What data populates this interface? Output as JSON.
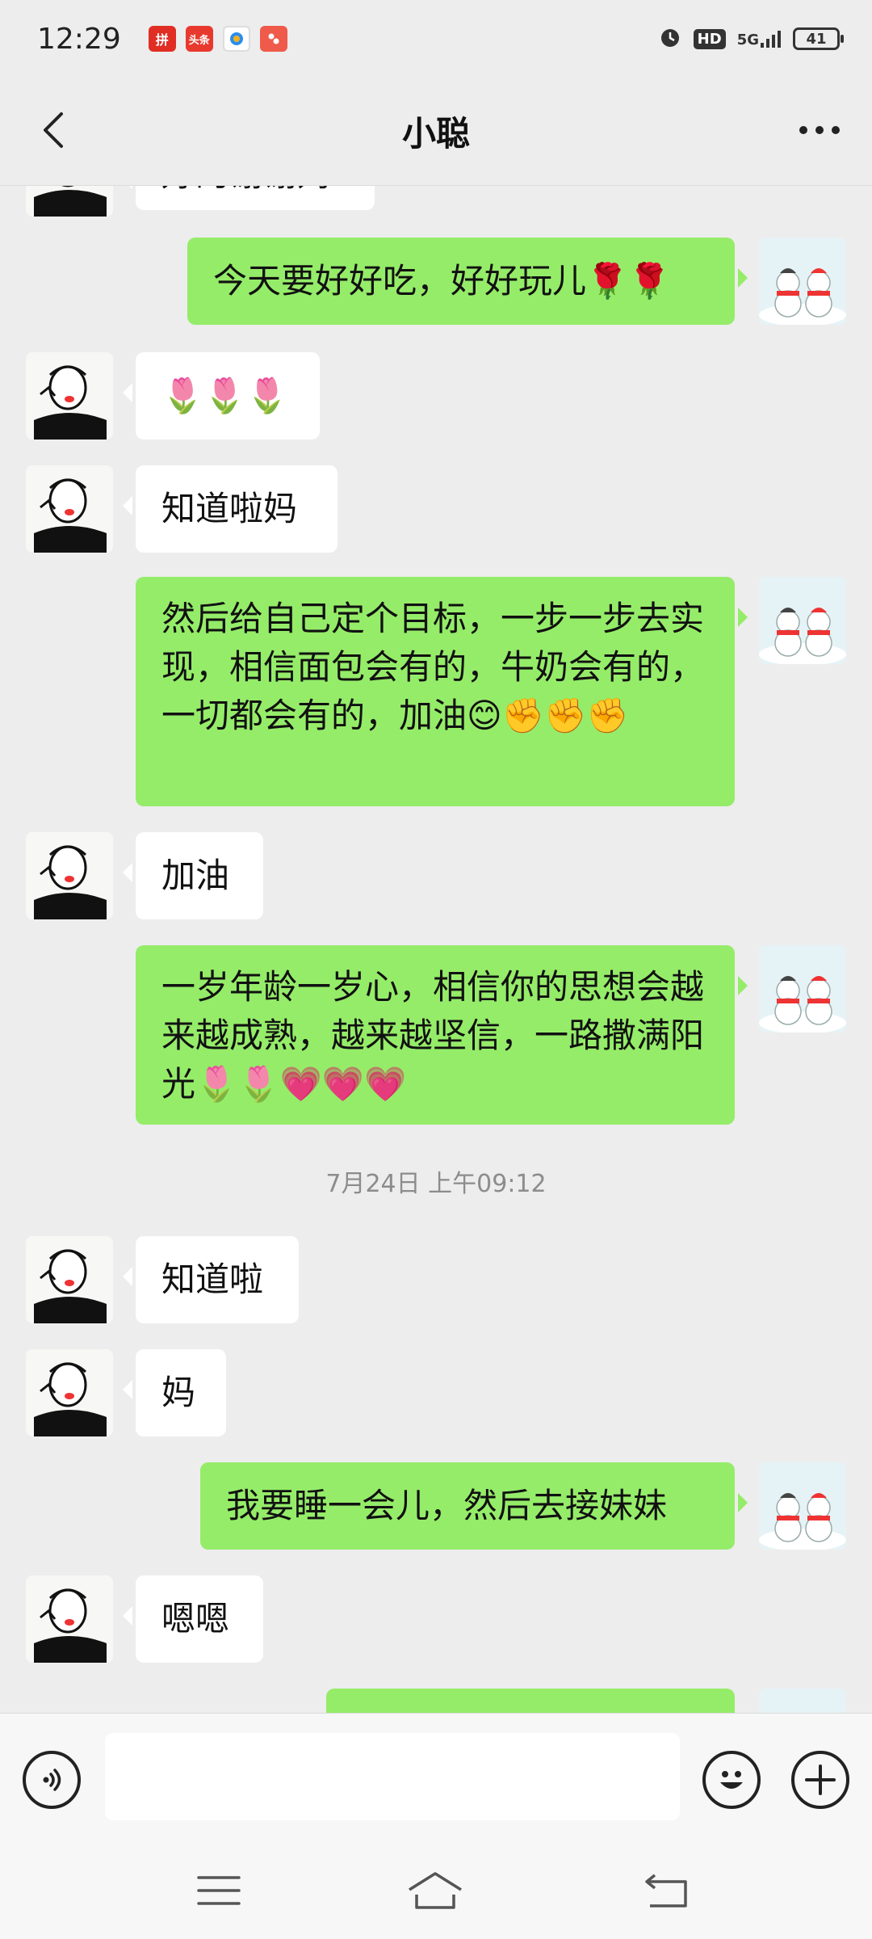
{
  "status_bar": {
    "time": "12:29",
    "notifications": [
      {
        "name": "pinduoduo-icon",
        "label": "拼",
        "color": "#e02e24"
      },
      {
        "name": "toutiao-icon",
        "label": "头条",
        "color": "#e8392f"
      },
      {
        "name": "browser-icon",
        "label": "",
        "color": "#2a8ef0"
      },
      {
        "name": "app-icon",
        "label": "",
        "color": "#ef5a4a"
      }
    ],
    "hd": "HD",
    "network": "5G",
    "battery": "41"
  },
  "header": {
    "title": "小聪",
    "back_icon": "chevron-left-icon",
    "more_icon": "more-dots-icon"
  },
  "messages": [
    {
      "id": "m0",
      "side": "other",
      "text": "好的谢谢妈",
      "partial": true
    },
    {
      "id": "m1",
      "side": "self",
      "text": "今天要好好吃，好好玩儿🌹🌹"
    },
    {
      "id": "m2",
      "side": "other",
      "text": "🌷🌷🌷"
    },
    {
      "id": "m3",
      "side": "other",
      "text": "知道啦妈"
    },
    {
      "id": "m4",
      "side": "self",
      "text": "然后给自己定个目标，一步一步去实现，相信面包会有的，牛奶会有的，一切都会有的，加油😊✊✊✊"
    },
    {
      "id": "m5",
      "side": "other",
      "text": "加油"
    },
    {
      "id": "m6",
      "side": "self",
      "text": "一岁年龄一岁心，相信你的思想会越来越成熟，越来越坚信，一路撒满阳光🌷🌷💗💗💗"
    },
    {
      "id": "m7",
      "side": "other",
      "text": "知道啦"
    },
    {
      "id": "m8",
      "side": "other",
      "text": "妈"
    },
    {
      "id": "m9",
      "side": "self",
      "text": "我要睡一会儿，然后去接妹妹"
    },
    {
      "id": "m10",
      "side": "other",
      "text": "嗯嗯"
    }
  ],
  "timestamp": "7月24日 上午09:12",
  "input_bar": {
    "voice_icon": "voice-icon",
    "text_value": "",
    "emoji_icon": "emoji-icon",
    "add_icon": "plus-icon"
  },
  "system_nav": {
    "menu_icon": "menu-icon",
    "home_icon": "home-icon",
    "back_icon": "back-icon"
  },
  "colors": {
    "background": "#ededed",
    "self_bubble": "#95ec69",
    "other_bubble": "#ffffff",
    "timestamp_text": "#8c8c8c"
  }
}
